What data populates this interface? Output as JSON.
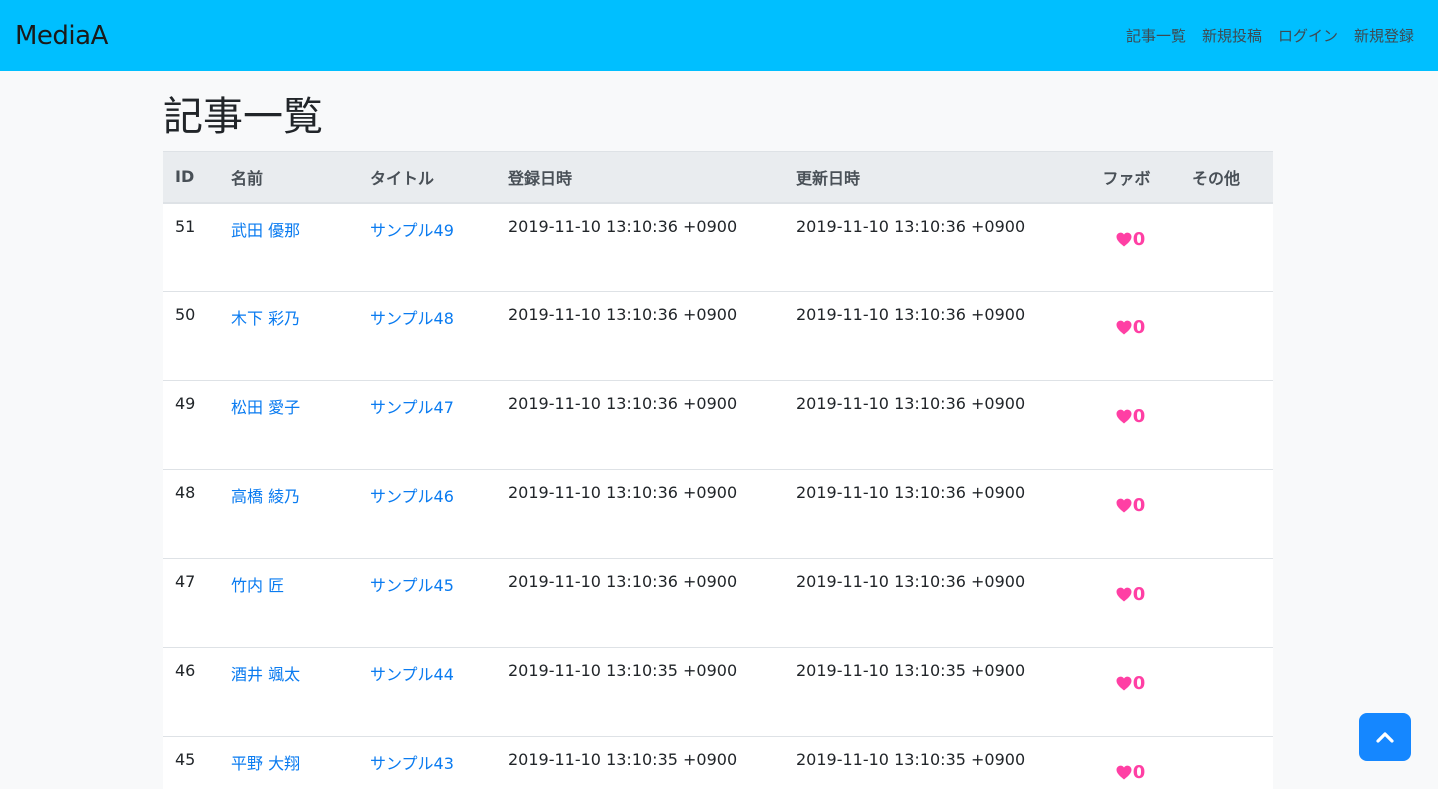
{
  "navbar": {
    "brand": "MediaA",
    "links": [
      "記事一覧",
      "新規投稿",
      "ログイン",
      "新規登録"
    ]
  },
  "page_title": "記事一覧",
  "table": {
    "headers": [
      "ID",
      "名前",
      "タイトル",
      "登録日時",
      "更新日時",
      "ファボ",
      "その他"
    ],
    "rows": [
      {
        "id": "51",
        "name": "武田 優那",
        "title": "サンプル49",
        "created": "2019-11-10 13:10:36 +0900",
        "updated": "2019-11-10 13:10:36 +0900",
        "fav": "0"
      },
      {
        "id": "50",
        "name": "木下 彩乃",
        "title": "サンプル48",
        "created": "2019-11-10 13:10:36 +0900",
        "updated": "2019-11-10 13:10:36 +0900",
        "fav": "0"
      },
      {
        "id": "49",
        "name": "松田 愛子",
        "title": "サンプル47",
        "created": "2019-11-10 13:10:36 +0900",
        "updated": "2019-11-10 13:10:36 +0900",
        "fav": "0"
      },
      {
        "id": "48",
        "name": "高橋 綾乃",
        "title": "サンプル46",
        "created": "2019-11-10 13:10:36 +0900",
        "updated": "2019-11-10 13:10:36 +0900",
        "fav": "0"
      },
      {
        "id": "47",
        "name": "竹内 匠",
        "title": "サンプル45",
        "created": "2019-11-10 13:10:36 +0900",
        "updated": "2019-11-10 13:10:36 +0900",
        "fav": "0"
      },
      {
        "id": "46",
        "name": "酒井 颯太",
        "title": "サンプル44",
        "created": "2019-11-10 13:10:35 +0900",
        "updated": "2019-11-10 13:10:35 +0900",
        "fav": "0"
      },
      {
        "id": "45",
        "name": "平野 大翔",
        "title": "サンプル43",
        "created": "2019-11-10 13:10:35 +0900",
        "updated": "2019-11-10 13:10:35 +0900",
        "fav": "0"
      }
    ]
  },
  "icons": {
    "fav": "heart-icon",
    "scroll_top": "chevron-up-icon"
  },
  "colors": {
    "navbar": "#00bfff",
    "link": "#0a7bf0",
    "fav": "#ff3fa4",
    "scroll_button": "#1587ff"
  }
}
